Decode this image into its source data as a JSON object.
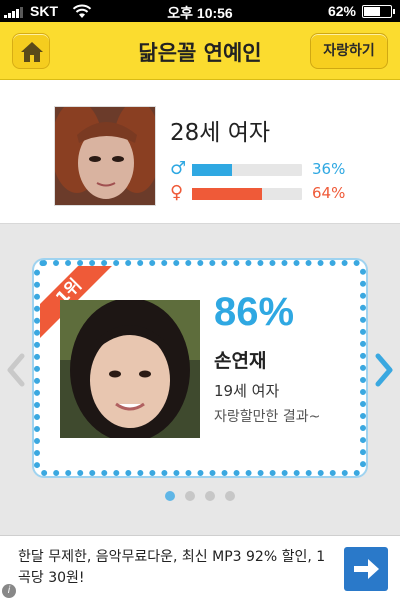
{
  "status_bar": {
    "carrier": "SKT",
    "time": "오후 10:56",
    "battery_percent_label": "62%",
    "battery_level": 0.62
  },
  "header": {
    "title": "닮은꼴 연예인",
    "share_label": "자랑하기",
    "home_icon": "home-icon",
    "background_color": "#fbdc2f"
  },
  "profile": {
    "description": "28세 여자",
    "male": {
      "symbol": "♂",
      "percent": 36,
      "label": "36%",
      "color": "#2fa8e2"
    },
    "female": {
      "symbol": "♀",
      "percent": 64,
      "label": "64%",
      "color": "#ef5a38"
    }
  },
  "result": {
    "rank_label": "1위",
    "match_percent": "86%",
    "name": "손연재",
    "info": "19세 여자",
    "comment": "자랑할만한 결과~",
    "accent_color": "#2fa8e2",
    "pagination": {
      "total": 4,
      "active": 1
    }
  },
  "ad": {
    "text": "한달 무제한, 음악무료다운, 최신 MP3 92% 할인, 1곡당 30원!",
    "button_icon": "arrow-right-icon"
  }
}
